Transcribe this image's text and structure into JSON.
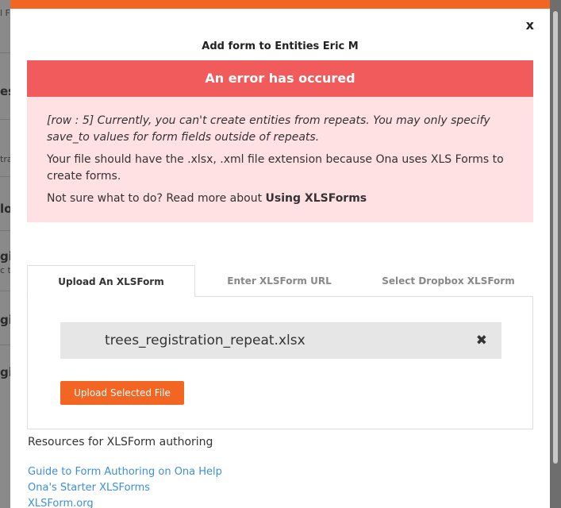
{
  "background": {
    "fragments": [
      "l F",
      "es,",
      "tra",
      "lov",
      "gis",
      "c t",
      "gis",
      "gis"
    ]
  },
  "modal": {
    "close_label": "x",
    "title": "Add form to Entities Eric M"
  },
  "error": {
    "header": "An error has occured",
    "message": "[row : 5] Currently, you can't create entities from repeats. You may only specify save_to values for form fields outside of repeats.",
    "extension_note": "Your file should have the .xlsx, .xml file extension because Ona uses XLS Forms to create forms.",
    "help_prefix": "Not sure what to do? Read more about ",
    "help_link": "Using XLSForms"
  },
  "tabs": [
    {
      "label": "Upload An XLSForm",
      "active": true
    },
    {
      "label": "Enter XLSForm URL",
      "active": false
    },
    {
      "label": "Select Dropbox XLSForm",
      "active": false
    }
  ],
  "upload": {
    "file_name": "trees_registration_repeat.xlsx",
    "remove_icon": "✖",
    "button_label": "Upload Selected File"
  },
  "resources": {
    "title": "Resources for XLSForm authoring",
    "links": [
      "Guide to Form Authoring on Ona Help",
      "Ona's Starter XLSForms",
      "XLSForm.org"
    ]
  },
  "colors": {
    "accent": "#f26522",
    "error_header": "#f25b5b",
    "error_body": "#ffe0e3",
    "link": "#3d8fd6"
  }
}
